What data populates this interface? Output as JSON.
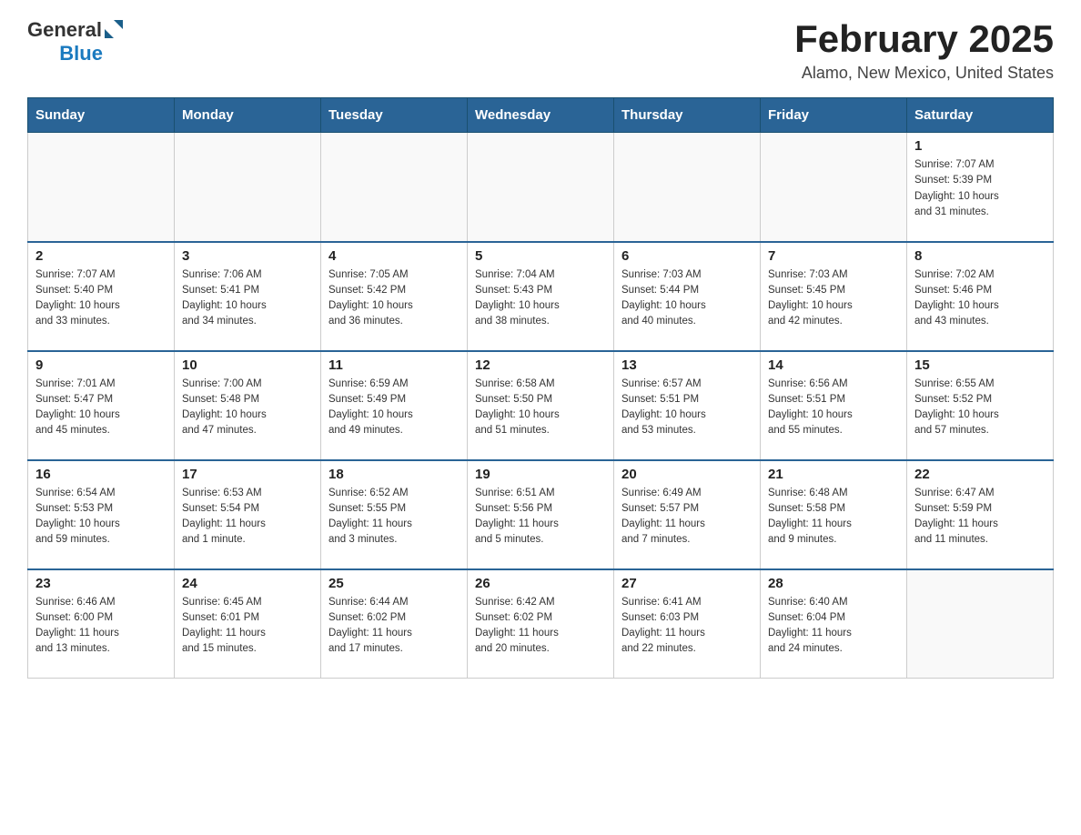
{
  "header": {
    "logo": {
      "general": "General",
      "blue": "Blue"
    },
    "title": "February 2025",
    "location": "Alamo, New Mexico, United States"
  },
  "weekdays": [
    "Sunday",
    "Monday",
    "Tuesday",
    "Wednesday",
    "Thursday",
    "Friday",
    "Saturday"
  ],
  "weeks": [
    [
      {
        "day": "",
        "info": ""
      },
      {
        "day": "",
        "info": ""
      },
      {
        "day": "",
        "info": ""
      },
      {
        "day": "",
        "info": ""
      },
      {
        "day": "",
        "info": ""
      },
      {
        "day": "",
        "info": ""
      },
      {
        "day": "1",
        "info": "Sunrise: 7:07 AM\nSunset: 5:39 PM\nDaylight: 10 hours\nand 31 minutes."
      }
    ],
    [
      {
        "day": "2",
        "info": "Sunrise: 7:07 AM\nSunset: 5:40 PM\nDaylight: 10 hours\nand 33 minutes."
      },
      {
        "day": "3",
        "info": "Sunrise: 7:06 AM\nSunset: 5:41 PM\nDaylight: 10 hours\nand 34 minutes."
      },
      {
        "day": "4",
        "info": "Sunrise: 7:05 AM\nSunset: 5:42 PM\nDaylight: 10 hours\nand 36 minutes."
      },
      {
        "day": "5",
        "info": "Sunrise: 7:04 AM\nSunset: 5:43 PM\nDaylight: 10 hours\nand 38 minutes."
      },
      {
        "day": "6",
        "info": "Sunrise: 7:03 AM\nSunset: 5:44 PM\nDaylight: 10 hours\nand 40 minutes."
      },
      {
        "day": "7",
        "info": "Sunrise: 7:03 AM\nSunset: 5:45 PM\nDaylight: 10 hours\nand 42 minutes."
      },
      {
        "day": "8",
        "info": "Sunrise: 7:02 AM\nSunset: 5:46 PM\nDaylight: 10 hours\nand 43 minutes."
      }
    ],
    [
      {
        "day": "9",
        "info": "Sunrise: 7:01 AM\nSunset: 5:47 PM\nDaylight: 10 hours\nand 45 minutes."
      },
      {
        "day": "10",
        "info": "Sunrise: 7:00 AM\nSunset: 5:48 PM\nDaylight: 10 hours\nand 47 minutes."
      },
      {
        "day": "11",
        "info": "Sunrise: 6:59 AM\nSunset: 5:49 PM\nDaylight: 10 hours\nand 49 minutes."
      },
      {
        "day": "12",
        "info": "Sunrise: 6:58 AM\nSunset: 5:50 PM\nDaylight: 10 hours\nand 51 minutes."
      },
      {
        "day": "13",
        "info": "Sunrise: 6:57 AM\nSunset: 5:51 PM\nDaylight: 10 hours\nand 53 minutes."
      },
      {
        "day": "14",
        "info": "Sunrise: 6:56 AM\nSunset: 5:51 PM\nDaylight: 10 hours\nand 55 minutes."
      },
      {
        "day": "15",
        "info": "Sunrise: 6:55 AM\nSunset: 5:52 PM\nDaylight: 10 hours\nand 57 minutes."
      }
    ],
    [
      {
        "day": "16",
        "info": "Sunrise: 6:54 AM\nSunset: 5:53 PM\nDaylight: 10 hours\nand 59 minutes."
      },
      {
        "day": "17",
        "info": "Sunrise: 6:53 AM\nSunset: 5:54 PM\nDaylight: 11 hours\nand 1 minute."
      },
      {
        "day": "18",
        "info": "Sunrise: 6:52 AM\nSunset: 5:55 PM\nDaylight: 11 hours\nand 3 minutes."
      },
      {
        "day": "19",
        "info": "Sunrise: 6:51 AM\nSunset: 5:56 PM\nDaylight: 11 hours\nand 5 minutes."
      },
      {
        "day": "20",
        "info": "Sunrise: 6:49 AM\nSunset: 5:57 PM\nDaylight: 11 hours\nand 7 minutes."
      },
      {
        "day": "21",
        "info": "Sunrise: 6:48 AM\nSunset: 5:58 PM\nDaylight: 11 hours\nand 9 minutes."
      },
      {
        "day": "22",
        "info": "Sunrise: 6:47 AM\nSunset: 5:59 PM\nDaylight: 11 hours\nand 11 minutes."
      }
    ],
    [
      {
        "day": "23",
        "info": "Sunrise: 6:46 AM\nSunset: 6:00 PM\nDaylight: 11 hours\nand 13 minutes."
      },
      {
        "day": "24",
        "info": "Sunrise: 6:45 AM\nSunset: 6:01 PM\nDaylight: 11 hours\nand 15 minutes."
      },
      {
        "day": "25",
        "info": "Sunrise: 6:44 AM\nSunset: 6:02 PM\nDaylight: 11 hours\nand 17 minutes."
      },
      {
        "day": "26",
        "info": "Sunrise: 6:42 AM\nSunset: 6:02 PM\nDaylight: 11 hours\nand 20 minutes."
      },
      {
        "day": "27",
        "info": "Sunrise: 6:41 AM\nSunset: 6:03 PM\nDaylight: 11 hours\nand 22 minutes."
      },
      {
        "day": "28",
        "info": "Sunrise: 6:40 AM\nSunset: 6:04 PM\nDaylight: 11 hours\nand 24 minutes."
      },
      {
        "day": "",
        "info": ""
      }
    ]
  ]
}
